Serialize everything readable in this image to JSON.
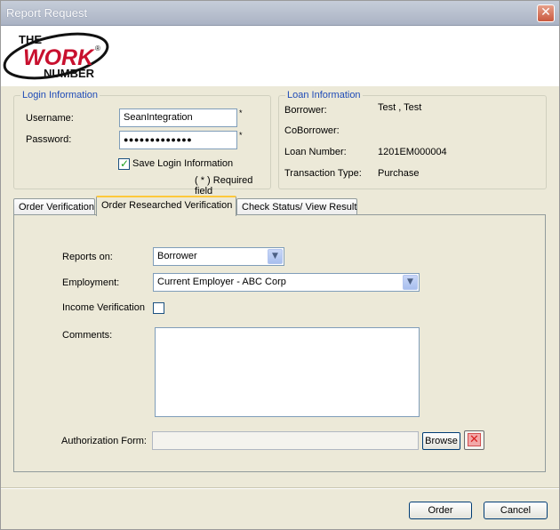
{
  "window": {
    "title": "Report Request",
    "close_glyph": "✕"
  },
  "logo": {
    "line1": "THE",
    "line2": "WORK",
    "line3": "NUMBER",
    "mark": "®",
    "icon": "the-work-number-logo"
  },
  "login": {
    "group_title": "Login Information",
    "username_label": "Username:",
    "username_value": "SeanIntegration",
    "password_label": "Password:",
    "password_value": "●●●●●●●●●●●●●",
    "required_marker": "*",
    "save_login_label": "Save Login Information",
    "save_login_checked": true,
    "required_note": "( * ) Required field"
  },
  "loan": {
    "group_title": "Loan Information",
    "borrower_label": "Borrower:",
    "borrower_value": "Test , Test",
    "coborrower_label": "CoBorrower:",
    "coborrower_value": "",
    "loan_number_label": "Loan Number:",
    "loan_number_value": "1201EM000004",
    "transaction_type_label": "Transaction Type:",
    "transaction_type_value": "Purchase"
  },
  "tabs": [
    {
      "label": "Order Verification",
      "active": false
    },
    {
      "label": "Order Researched Verification",
      "active": true
    },
    {
      "label": "Check Status/ View Result",
      "active": false
    }
  ],
  "form": {
    "reports_on_label": "Reports on:",
    "reports_on_value": "Borrower",
    "employment_label": "Employment:",
    "employment_value": "Current Employer - ABC Corp",
    "income_verification_label": "Income Verification",
    "income_verification_checked": false,
    "comments_label": "Comments:",
    "comments_value": "",
    "authorization_label": "Authorization Form:",
    "authorization_value": "",
    "browse_label": "Browse",
    "dropdown_glyph": "▼"
  },
  "footer": {
    "order_label": "Order",
    "cancel_label": "Cancel"
  },
  "colors": {
    "group_title": "#1f4bb7",
    "active_tab_accent": "#ffc83c",
    "window_bg": "#ece9d8"
  }
}
